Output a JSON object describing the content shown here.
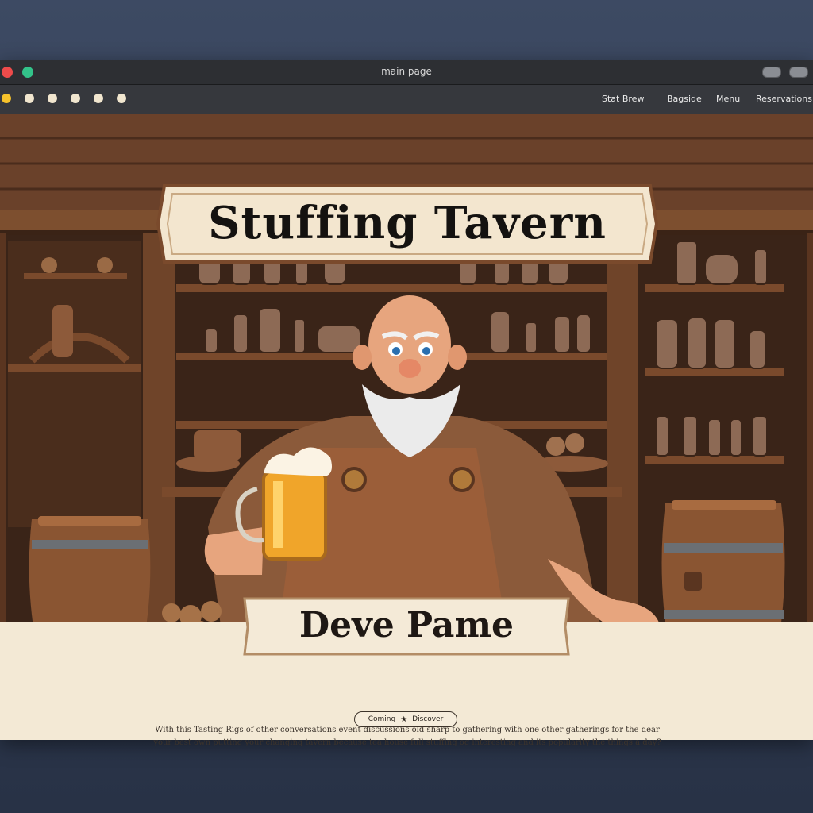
{
  "window": {
    "title": "main page"
  },
  "toolbar": {
    "nav": [
      "Stat Brew",
      "Bagside",
      "Menu",
      "Reservations"
    ]
  },
  "hero": {
    "sign_title": "Stuffing Tavern",
    "banner_title": "Deve Pame"
  },
  "content": {
    "description_line1": "With this Tasting Rigs of other conversations event discussions old sharp to gathering with one other gatherings for the dear",
    "description_line2": "your best own putting your changing tavern because tea house full stuffing og interesting and its popularity the things a day?",
    "cta_left": "Coming",
    "cta_icon": "star-icon",
    "cta_right": "Discover"
  },
  "colors": {
    "wood_dark": "#4a2d1c",
    "wood_mid": "#7a4a2c",
    "parchment": "#efe3cc",
    "titlebar": "#2d2f33"
  }
}
